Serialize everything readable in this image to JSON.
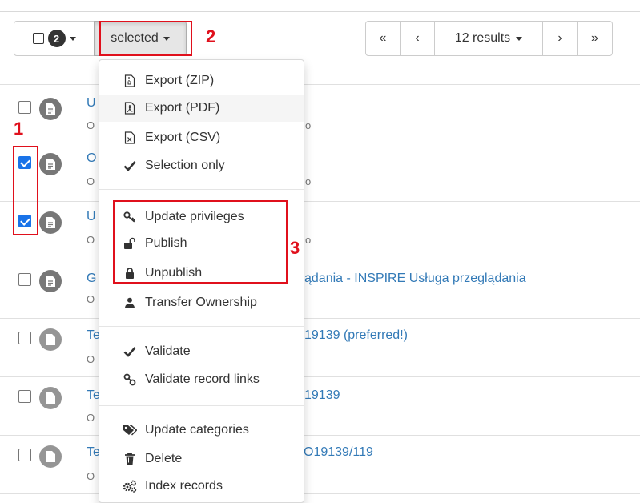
{
  "toolbar": {
    "selected_count": "2",
    "selected_label": "selected"
  },
  "pager": {
    "first": "«",
    "prev": "‹",
    "results_label": "12 results",
    "next": "›",
    "last": "»"
  },
  "records": [
    {
      "title": "U",
      "subtitle": "O",
      "title_suffix": "",
      "sub_suffix": "o",
      "checked": false,
      "icon": "document-icon"
    },
    {
      "title": "O",
      "subtitle": "O",
      "title_suffix": "",
      "sub_suffix": "o",
      "checked": true,
      "icon": "document-icon"
    },
    {
      "title": "U",
      "subtitle": "O",
      "title_suffix": "",
      "sub_suffix": "o",
      "checked": true,
      "icon": "document-icon"
    },
    {
      "title": "G",
      "subtitle": "O",
      "title_suffix": "ądania - INSPIRE Usługa przeglądania",
      "sub_suffix": "",
      "checked": false,
      "icon": "document-icon"
    },
    {
      "title": "Te",
      "subtitle": "O",
      "title_suffix": "19139 (preferred!)",
      "sub_suffix": "",
      "checked": false,
      "icon": "file-icon"
    },
    {
      "title": "Te",
      "subtitle": "O",
      "title_suffix": "19139",
      "sub_suffix": "",
      "checked": false,
      "icon": "file-icon"
    },
    {
      "title": "Te",
      "subtitle": "O",
      "title_suffix": "O19139/119",
      "sub_suffix": "",
      "checked": false,
      "icon": "file-icon"
    }
  ],
  "menu": {
    "export_zip": "Export (ZIP)",
    "export_pdf": "Export (PDF)",
    "export_csv": "Export (CSV)",
    "selection_only": "Selection only",
    "update_privileges": "Update privileges",
    "publish": "Publish",
    "unpublish": "Unpublish",
    "transfer_ownership": "Transfer Ownership",
    "validate": "Validate",
    "validate_links": "Validate record links",
    "update_categories": "Update categories",
    "delete": "Delete",
    "index_records": "Index records"
  },
  "annotations": {
    "n1": "1",
    "n2": "2",
    "n3": "3",
    "color": "#e0101c"
  }
}
